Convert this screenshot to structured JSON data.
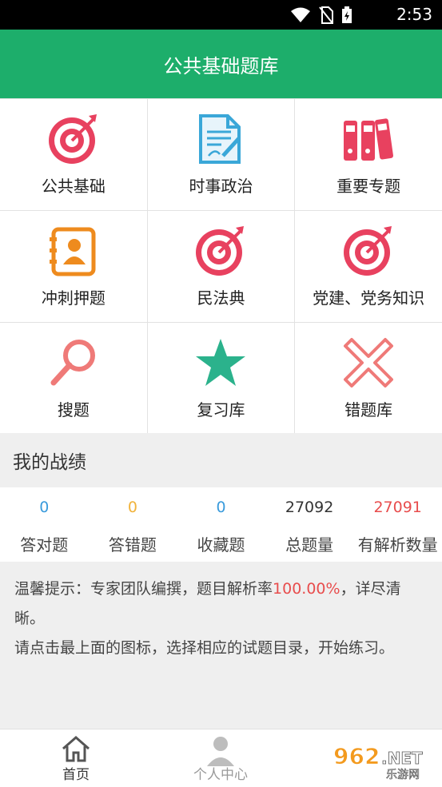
{
  "status_bar": {
    "time": "2:53"
  },
  "header": {
    "title": "公共基础题库"
  },
  "grid": [
    {
      "label": "公共基础",
      "icon": "target-icon"
    },
    {
      "label": "时事政治",
      "icon": "document-icon"
    },
    {
      "label": "重要专题",
      "icon": "binders-icon"
    },
    {
      "label": "冲刺押题",
      "icon": "contact-book-icon"
    },
    {
      "label": "民法典",
      "icon": "target-icon"
    },
    {
      "label": "党建、党务知识",
      "icon": "target-icon"
    },
    {
      "label": "搜题",
      "icon": "search-icon"
    },
    {
      "label": "复习库",
      "icon": "star-icon"
    },
    {
      "label": "错题库",
      "icon": "cross-icon"
    }
  ],
  "section": {
    "title": "我的战绩"
  },
  "stats": [
    {
      "value": "0",
      "label": "答对题",
      "color": "#3a9bdc"
    },
    {
      "value": "0",
      "label": "答错题",
      "color": "#f1b33b"
    },
    {
      "value": "0",
      "label": "收藏题",
      "color": "#3a9bdc"
    },
    {
      "value": "27092",
      "label": "总题量",
      "color": "#333333"
    },
    {
      "value": "27091",
      "label": "有解析数量",
      "color": "#e84d4d"
    }
  ],
  "tips": {
    "prefix": "温馨提示：专家团队编撰，题目解析率",
    "rate": "100.00%",
    "suffix": "，详尽清晰。",
    "line2": "请点击最上面的图标，选择相应的试题目录，开始练习。"
  },
  "bottom_nav": [
    {
      "label": "首页",
      "active": true
    },
    {
      "label": "个人中心",
      "active": false
    }
  ],
  "watermark": {
    "number": "962",
    "tld": ".NET",
    "sub": "乐游网"
  },
  "colors": {
    "header": "#1dae6b",
    "target": "#e8415f",
    "star": "#2bb28c",
    "doc": "#3aa7d8",
    "contact": "#ee8b1e",
    "search": "#ef7a78"
  }
}
